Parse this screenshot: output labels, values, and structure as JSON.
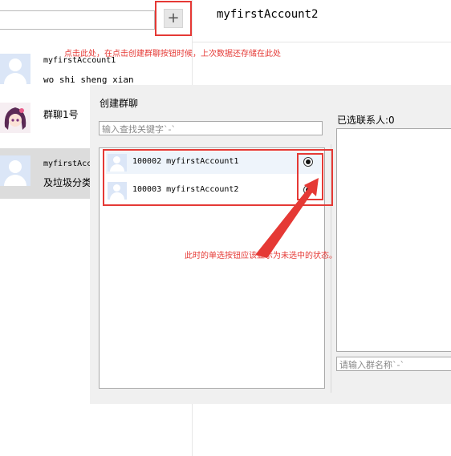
{
  "chat_header": {
    "title": "myfirstAccount2"
  },
  "toolbar": {
    "add_label": "+"
  },
  "chat_list": [
    {
      "name": "myfirstAccount1",
      "message": "wo shi sheng xian"
    },
    {
      "name": "群聊1号",
      "message": ""
    },
    {
      "name": "myfirstAcc",
      "message": "及垃圾分类"
    }
  ],
  "dialog": {
    "title": "创建群聊",
    "search_placeholder": "输入查找关键字`-`",
    "contacts": [
      {
        "label": "100002 myfirstAccount1"
      },
      {
        "label": "100003 myfirstAccount2"
      }
    ],
    "selected_label": "已选联系人:0",
    "group_name_placeholder": "请输入群名称`-`"
  },
  "annotations": {
    "note_top": "点击此处，在点击创建群聊按钮时候，上次数据还存储在此处",
    "note_radio": "此时的单选按钮应该显示为未选中的状态。"
  },
  "colors": {
    "annotation": "#e53935",
    "avatar_bg": "#dbe6f7",
    "dialog_bg": "#f0f0f0"
  }
}
